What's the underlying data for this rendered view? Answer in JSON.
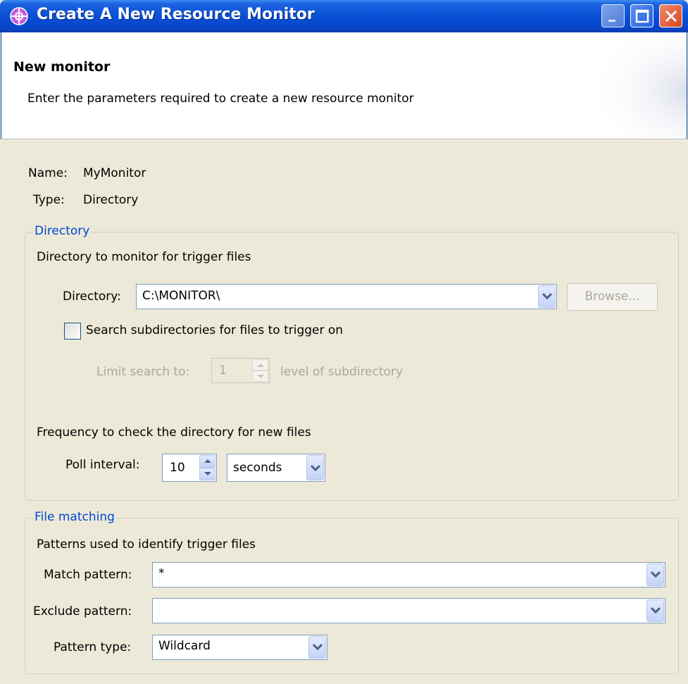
{
  "window": {
    "title": "Create A New Resource Monitor",
    "titlebar_color": "#0a4fd6"
  },
  "header": {
    "title": "New monitor",
    "description": "Enter the parameters required to create a new resource monitor"
  },
  "info": {
    "name_label": "Name:",
    "name_value": "MyMonitor",
    "type_label": "Type:",
    "type_value": "Directory"
  },
  "directory_group": {
    "legend": "Directory",
    "description": "Directory to monitor for trigger files",
    "directory_label": "Directory:",
    "directory_value": "C:\\MONITOR\\",
    "browse_label": "Browse...",
    "subdirs_checkbox_label": "Search subdirectories for files to trigger on",
    "subdirs_checked": false,
    "limit_label": "Limit search to:",
    "limit_value": "1",
    "limit_suffix": "level of subdirectory",
    "frequency_description": "Frequency to check the directory for new files",
    "poll_label": "Poll interval:",
    "poll_value": "10",
    "poll_unit": "seconds"
  },
  "file_matching_group": {
    "legend": "File matching",
    "description": "Patterns used to identify trigger files",
    "match_label": "Match pattern:",
    "match_value": "*",
    "exclude_label": "Exclude pattern:",
    "exclude_value": "",
    "pattern_type_label": "Pattern type:",
    "pattern_type_value": "Wildcard"
  },
  "colors": {
    "legend_text": "#0046d5",
    "dialog_bg": "#ece9d8",
    "disabled_text": "#aca899"
  }
}
